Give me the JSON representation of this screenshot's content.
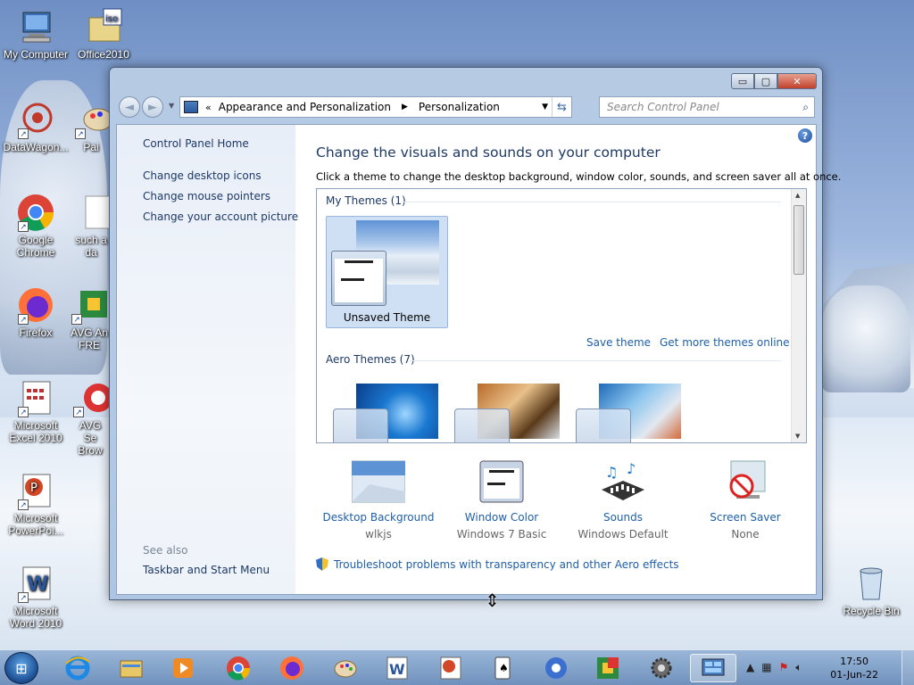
{
  "desktop": {
    "icons": [
      {
        "label": "My Computer"
      },
      {
        "label": "Office2010"
      },
      {
        "label": "DataWagon..."
      },
      {
        "label": "Pai"
      },
      {
        "label": "Google Chrome"
      },
      {
        "label": "such a da"
      },
      {
        "label": "Firefox"
      },
      {
        "label": "AVG An FRE"
      },
      {
        "label": "Microsoft Excel 2010"
      },
      {
        "label": "AVG Se Brow"
      },
      {
        "label": "Microsoft PowerPoi..."
      },
      {
        "label": "Microsoft Word 2010"
      },
      {
        "label": "Recycle Bin"
      }
    ]
  },
  "window": {
    "caption_buttons": {
      "minimize": "▭",
      "maximize": "▢",
      "close": "✕"
    },
    "nav": {
      "back": "◄",
      "forward": "►",
      "address_prefix": "«",
      "breadcrumbs": [
        "Appearance and Personalization",
        "Personalization"
      ],
      "search_placeholder": "Search Control Panel"
    },
    "left_pane": {
      "home": "Control Panel Home",
      "links": [
        "Change desktop icons",
        "Change mouse pointers",
        "Change your account picture"
      ],
      "see_also_label": "See also",
      "see_also_links": [
        "Taskbar and Start Menu"
      ]
    },
    "main": {
      "heading": "Change the visuals and sounds on your computer",
      "subheading": "Click a theme to change the desktop background, window color, sounds, and screen saver all at once.",
      "my_themes_label": "My Themes (1)",
      "unsaved_theme_label": "Unsaved Theme",
      "save_theme": "Save theme",
      "get_more_themes": "Get more themes online",
      "aero_themes_label": "Aero Themes (7)",
      "options": [
        {
          "title": "Desktop Background",
          "subtitle": "wlkjs",
          "icon": "desktop-background-icon"
        },
        {
          "title": "Window Color",
          "subtitle": "Windows 7 Basic",
          "icon": "window-color-icon"
        },
        {
          "title": "Sounds",
          "subtitle": "Windows Default",
          "icon": "sounds-icon"
        },
        {
          "title": "Screen Saver",
          "subtitle": "None",
          "icon": "screen-saver-icon"
        }
      ],
      "troubleshoot": "Troubleshoot problems with transparency and other Aero effects"
    }
  },
  "taskbar": {
    "pinned": [
      "internet-explorer-icon",
      "file-explorer-icon",
      "media-player-icon",
      "chrome-icon",
      "firefox-icon",
      "paint-icon",
      "word-icon",
      "powerpoint-icon",
      "solitaire-icon",
      "media-center-icon",
      "avg-icon",
      "settings-icon",
      "control-panel-icon"
    ],
    "clock_time": "17:50",
    "clock_date": "01-Jun-22"
  },
  "colors": {
    "link": "#1f5fa8",
    "heading": "#1e3966",
    "selection": "#cfe0f4"
  }
}
